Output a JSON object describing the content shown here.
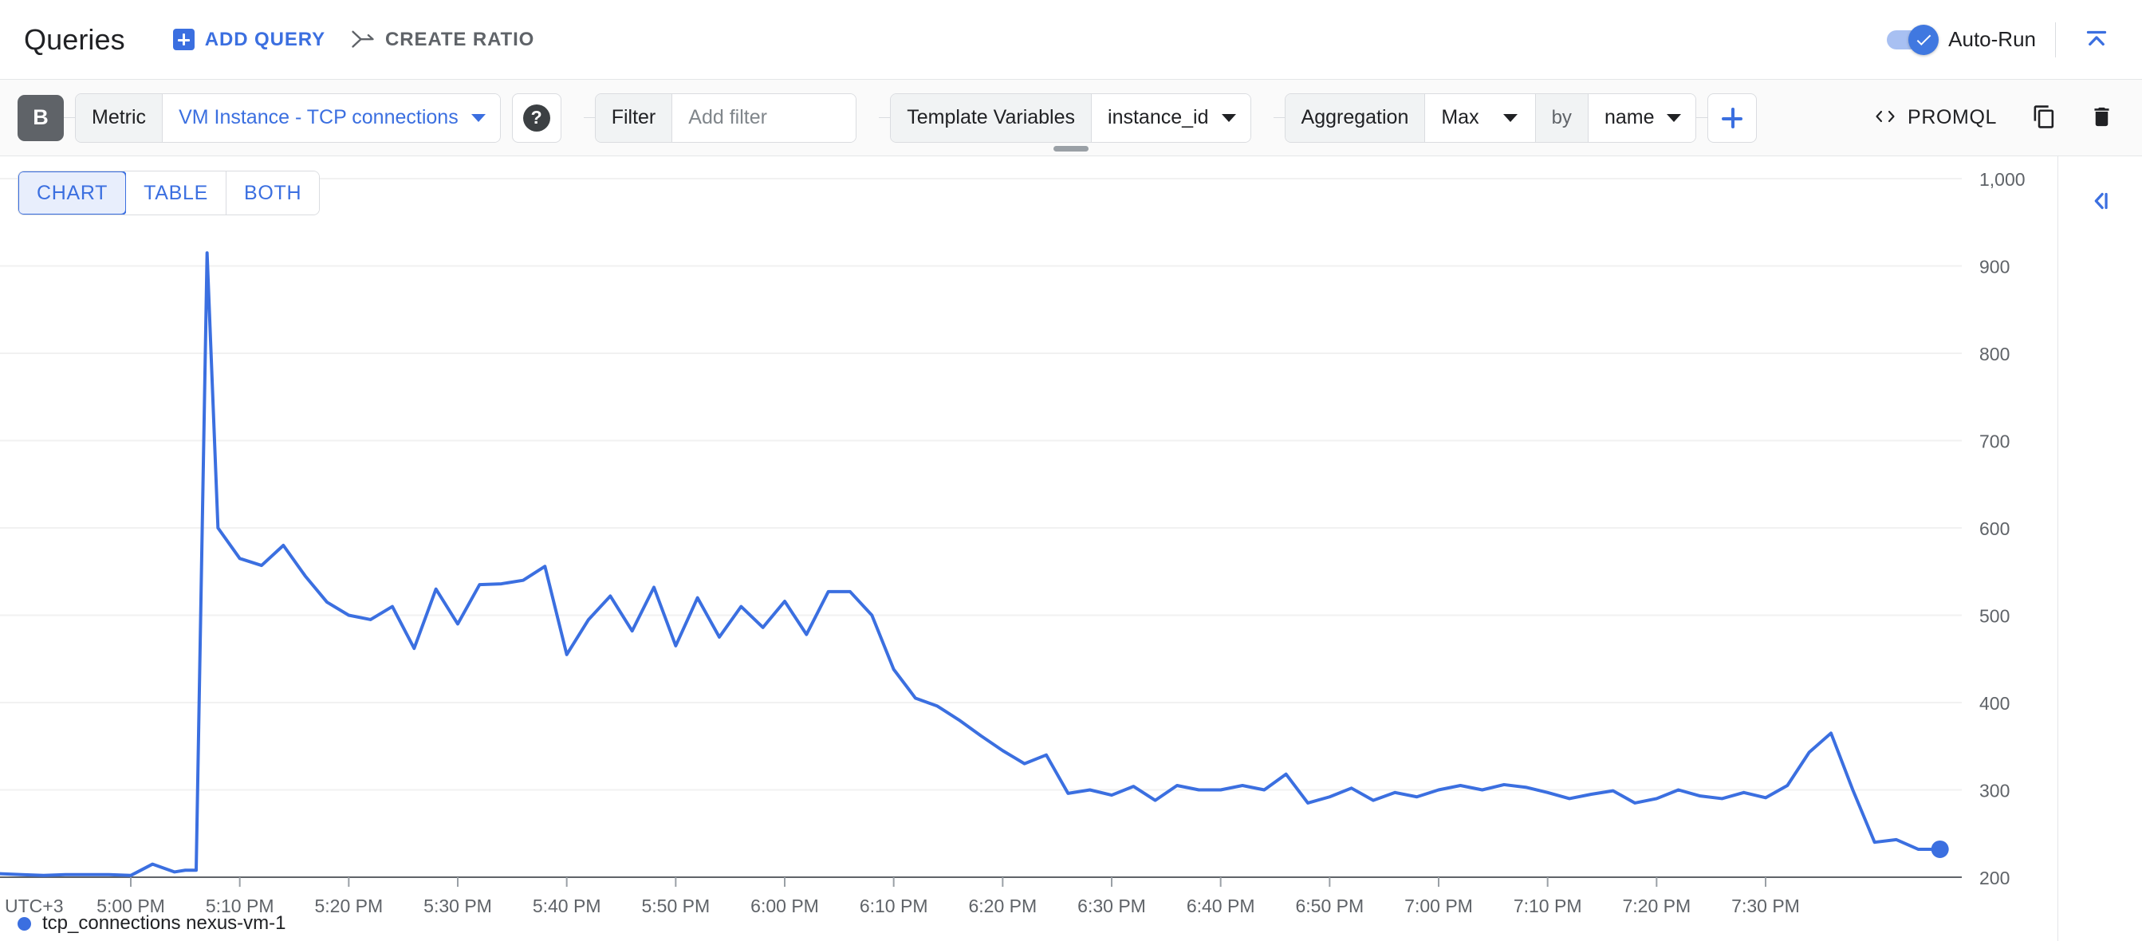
{
  "header": {
    "title": "Queries",
    "add_query_label": "ADD QUERY",
    "create_ratio_label": "CREATE RATIO",
    "auto_run_label": "Auto-Run",
    "auto_run_enabled": true,
    "icons": {
      "add": "plus-square-icon",
      "ratio": "create-ratio-icon",
      "collapse": "collapse-up-icon"
    }
  },
  "toolbar": {
    "query_badge": "B",
    "metric_label": "Metric",
    "metric_value": "VM Instance - TCP connections",
    "help_label": "?",
    "filter_label": "Filter",
    "filter_placeholder": "Add filter",
    "filter_value": "",
    "template_variables_label": "Template Variables",
    "template_variables_value": "instance_id",
    "aggregation_label": "Aggregation",
    "aggregation_value": "Max",
    "by_label": "by",
    "by_value": "name",
    "add_label": "+",
    "promql_label": "PROMQL",
    "promql_icon": "code-brackets-icon",
    "duplicate_icon": "copy-icon",
    "delete_icon": "trash-icon"
  },
  "view_tabs": [
    {
      "label": "CHART",
      "active": true
    },
    {
      "label": "TABLE",
      "active": false
    },
    {
      "label": "BOTH",
      "active": false
    }
  ],
  "right_rail": {
    "expand_icon": "collapse-left-panel-icon"
  },
  "colors": {
    "accent": "#3b6fe0",
    "series": "#3b6fe0",
    "toolbar_bg": "#fafafa",
    "badge_bg": "#5f6368",
    "grid": "#f1f1f1",
    "axis": "#80868b"
  },
  "legend": [
    {
      "label": "tcp_connections nexus-vm-1",
      "color": "#3b6fe0"
    }
  ],
  "chart_data": {
    "type": "line",
    "title": "",
    "xlabel": "",
    "ylabel": "",
    "timezone_label": "UTC+3",
    "grid": true,
    "legend_position": "bottom-left",
    "ylim": [
      200,
      1000
    ],
    "yticks": [
      200,
      300,
      400,
      500,
      600,
      700,
      800,
      900,
      1000
    ],
    "ytick_labels": [
      "200",
      "300",
      "400",
      "500",
      "600",
      "700",
      "800",
      "900",
      "1,000"
    ],
    "xticks": [
      "5:00 PM",
      "5:10 PM",
      "5:20 PM",
      "5:30 PM",
      "5:40 PM",
      "5:50 PM",
      "6:00 PM",
      "6:10 PM",
      "6:20 PM",
      "6:30 PM",
      "6:40 PM",
      "6:50 PM",
      "7:00 PM",
      "7:10 PM",
      "7:20 PM",
      "7:30 PM"
    ],
    "xlim_minutes": [
      -12,
      168
    ],
    "end_marker": true,
    "series": [
      {
        "name": "tcp_connections nexus-vm-1",
        "color": "#3b6fe0",
        "x_minutes": [
          -12,
          -10,
          -8,
          -6,
          -4,
          -2,
          0,
          2,
          4,
          5,
          6,
          7,
          8,
          10,
          12,
          14,
          16,
          18,
          20,
          22,
          24,
          26,
          28,
          30,
          32,
          34,
          36,
          38,
          40,
          42,
          44,
          46,
          48,
          50,
          52,
          54,
          56,
          58,
          60,
          62,
          64,
          66,
          68,
          70,
          72,
          74,
          76,
          78,
          80,
          82,
          84,
          86,
          88,
          90,
          92,
          94,
          96,
          98,
          100,
          102,
          104,
          106,
          108,
          110,
          112,
          114,
          116,
          118,
          120,
          122,
          124,
          126,
          128,
          130,
          132,
          134,
          136,
          138,
          140,
          142,
          144,
          146,
          148,
          150,
          152,
          154,
          156,
          158,
          160,
          162,
          164,
          166
        ],
        "values": [
          204,
          203,
          202,
          203,
          203,
          203,
          202,
          215,
          206,
          208,
          208,
          915,
          600,
          565,
          557,
          580,
          545,
          515,
          500,
          495,
          510,
          462,
          530,
          490,
          535,
          536,
          540,
          556,
          455,
          495,
          522,
          482,
          532,
          465,
          520,
          475,
          510,
          486,
          516,
          478,
          527,
          527,
          500,
          438,
          405,
          396,
          380,
          362,
          345,
          330,
          340,
          296,
          300,
          294,
          304,
          288,
          305,
          300,
          300,
          305,
          300,
          318,
          285,
          292,
          302,
          288,
          297,
          292,
          300,
          305,
          300,
          306,
          303,
          297,
          290,
          295,
          299,
          285,
          290,
          300,
          293,
          290,
          297,
          291,
          305,
          343,
          365,
          300,
          240,
          243,
          232,
          232
        ]
      }
    ]
  }
}
